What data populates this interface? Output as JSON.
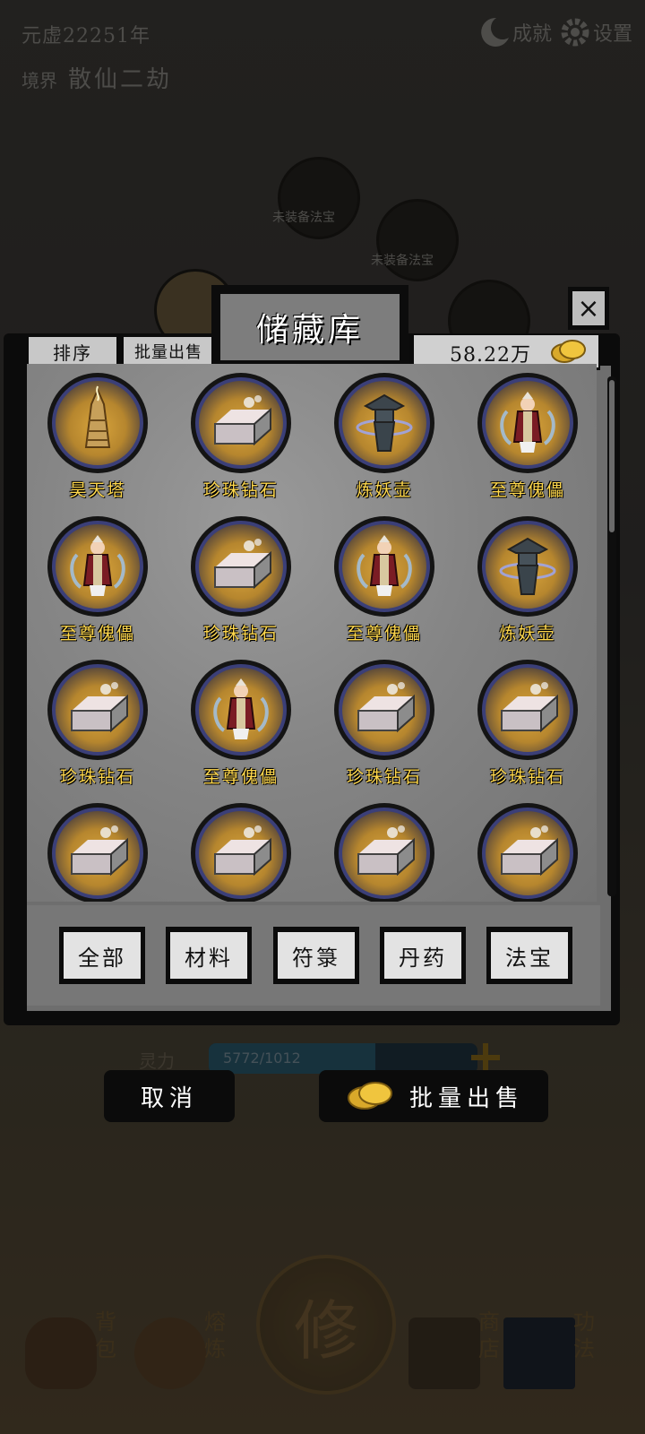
{
  "top": {
    "era": "元虚22251年",
    "realm_label": "境界",
    "realm_value": "散仙二劫",
    "achievements_label": "成就",
    "settings_label": "设置"
  },
  "slots": [
    {
      "label": "未装备法宝"
    },
    {
      "label": "未装备法宝"
    }
  ],
  "stat": {
    "label": "灵力",
    "value": "5772/1012",
    "fill": 0.62
  },
  "nav": {
    "center": "修",
    "items": [
      {
        "label": "背包",
        "icon": "bag-icon"
      },
      {
        "label": "熔炼",
        "icon": "smelt-icon"
      },
      {
        "label": "商店",
        "icon": "scroll-icon"
      },
      {
        "label": "功法",
        "icon": "book-icon"
      }
    ]
  },
  "storage": {
    "title": "储藏库",
    "close": "×",
    "sort_label": "排序",
    "bulk_sell_label": "批量出售",
    "coins": "58.22万",
    "items": [
      {
        "name": "昊天塔",
        "icon": "tower-icon"
      },
      {
        "name": "珍珠钻石",
        "icon": "pearl-diamond-icon"
      },
      {
        "name": "炼妖壶",
        "icon": "demon-pot-icon"
      },
      {
        "name": "至尊傀儡",
        "icon": "puppet-icon"
      },
      {
        "name": "至尊傀儡",
        "icon": "puppet-icon"
      },
      {
        "name": "珍珠钻石",
        "icon": "pearl-diamond-icon"
      },
      {
        "name": "至尊傀儡",
        "icon": "puppet-icon"
      },
      {
        "name": "炼妖壶",
        "icon": "demon-pot-icon"
      },
      {
        "name": "珍珠钻石",
        "icon": "pearl-diamond-icon"
      },
      {
        "name": "至尊傀儡",
        "icon": "puppet-icon"
      },
      {
        "name": "珍珠钻石",
        "icon": "pearl-diamond-icon"
      },
      {
        "name": "珍珠钻石",
        "icon": "pearl-diamond-icon"
      },
      {
        "name": "",
        "icon": "pearl-diamond-icon"
      },
      {
        "name": "",
        "icon": "pearl-diamond-icon"
      },
      {
        "name": "",
        "icon": "pearl-diamond-icon"
      },
      {
        "name": "",
        "icon": "pearl-diamond-icon"
      }
    ],
    "tabs": [
      "全部",
      "材料",
      "符箓",
      "丹药",
      "法宝"
    ],
    "cancel_label": "取消",
    "confirm_bulk_sell_label": "批量出售"
  }
}
